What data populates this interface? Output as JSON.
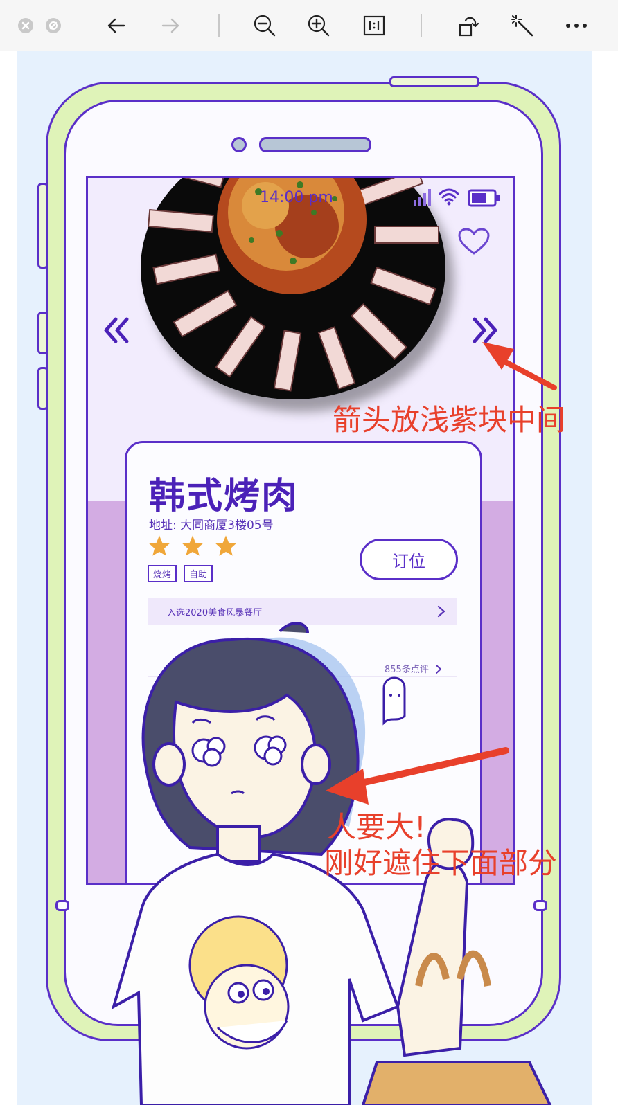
{
  "toolbar": {
    "buttons": [
      "close-window",
      "minimize-window",
      "back",
      "forward",
      "zoom-out",
      "zoom-in",
      "actual-size",
      "rotate",
      "enhance",
      "more"
    ]
  },
  "phone": {
    "status_time": "14:00 pm"
  },
  "restaurant": {
    "name": "韩式烤肉",
    "address": "地址: 大同商厦3楼05号",
    "rating_stars": 3,
    "tags": [
      "烧烤",
      "自助"
    ],
    "book_label": "订位",
    "award_text": "入选2020美食风暴餐厅",
    "reviews_text": "855条点评"
  },
  "annotations": {
    "arrow_note": "箭头放浅紫块中间",
    "person_note_line1": "人要大!",
    "person_note_line2": "刚好遮住下面部分"
  },
  "colors": {
    "outline": "#5a2fc8",
    "phone_body": "#dff3b8",
    "screen_bg": "#f2ecfd",
    "lower_panel": "#d3ace3",
    "annotation_red": "#e8402b",
    "star": "#f0a73a"
  }
}
